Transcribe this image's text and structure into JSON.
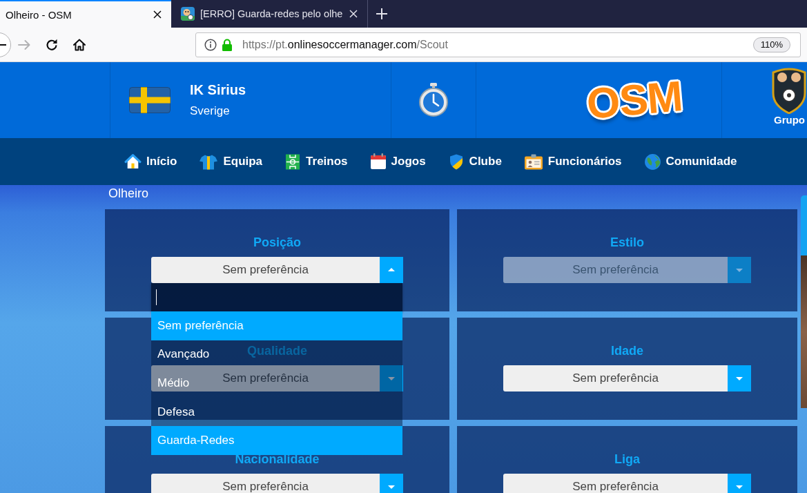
{
  "browser": {
    "tabs": [
      {
        "title": "Olheiro - OSM",
        "selected": true,
        "favicon": false
      },
      {
        "title": "[ERRO] Guarda-redes pelo olhe",
        "selected": false,
        "favicon": true
      }
    ],
    "nav_buttons": [
      {
        "kind": "back",
        "disabled": false
      },
      {
        "kind": "forward",
        "disabled": true
      },
      {
        "kind": "reload",
        "disabled": false
      },
      {
        "kind": "home",
        "disabled": false
      }
    ],
    "address_bar": {
      "secure": true,
      "url_parts": [
        {
          "text": "https://pt.",
          "kind": "dim"
        },
        {
          "text": "onlinesoccermanager.com",
          "kind": "host"
        },
        {
          "text": "/Scout",
          "kind": "dim"
        }
      ],
      "zoom": "110%"
    }
  },
  "header": {
    "club": {
      "name": "IK Sirius",
      "country": "Sverige"
    },
    "logo": "OSM",
    "group_label": "Grupo"
  },
  "nav": [
    {
      "label": "Início",
      "kind": "home"
    },
    {
      "label": "Equipa",
      "kind": "team"
    },
    {
      "label": "Treinos",
      "kind": "training"
    },
    {
      "label": "Jogos",
      "kind": "matches"
    },
    {
      "label": "Clube",
      "kind": "club"
    },
    {
      "label": "Funcionários",
      "kind": "staff"
    },
    {
      "label": "Comunidade",
      "kind": "community"
    }
  ],
  "page_title": "Olheiro",
  "filters": [
    {
      "title": "Posição",
      "value": "Sem preferência",
      "disabled": false,
      "open": true,
      "dropdown": {
        "searchable": true,
        "options": [
          {
            "label": "Sem preferência",
            "highlighted": true
          },
          {
            "label": "Avançado",
            "highlighted": false
          },
          {
            "label": "Médio",
            "highlighted": false
          },
          {
            "label": "Defesa",
            "highlighted": false
          },
          {
            "label": "Guarda-Redes",
            "highlighted": true
          }
        ]
      }
    },
    {
      "title": "Estilo",
      "value": "Sem preferência",
      "disabled": true,
      "open": false
    },
    {
      "title": "Qualidade",
      "value": "Sem preferência",
      "disabled": false,
      "open": false
    },
    {
      "title": "Idade",
      "value": "Sem preferência",
      "disabled": false,
      "open": false
    },
    {
      "title": "Nacionalidade",
      "value": "Sem preferência",
      "disabled": false,
      "open": false
    },
    {
      "title": "Liga",
      "value": "Sem preferência",
      "disabled": false,
      "open": false
    }
  ]
}
